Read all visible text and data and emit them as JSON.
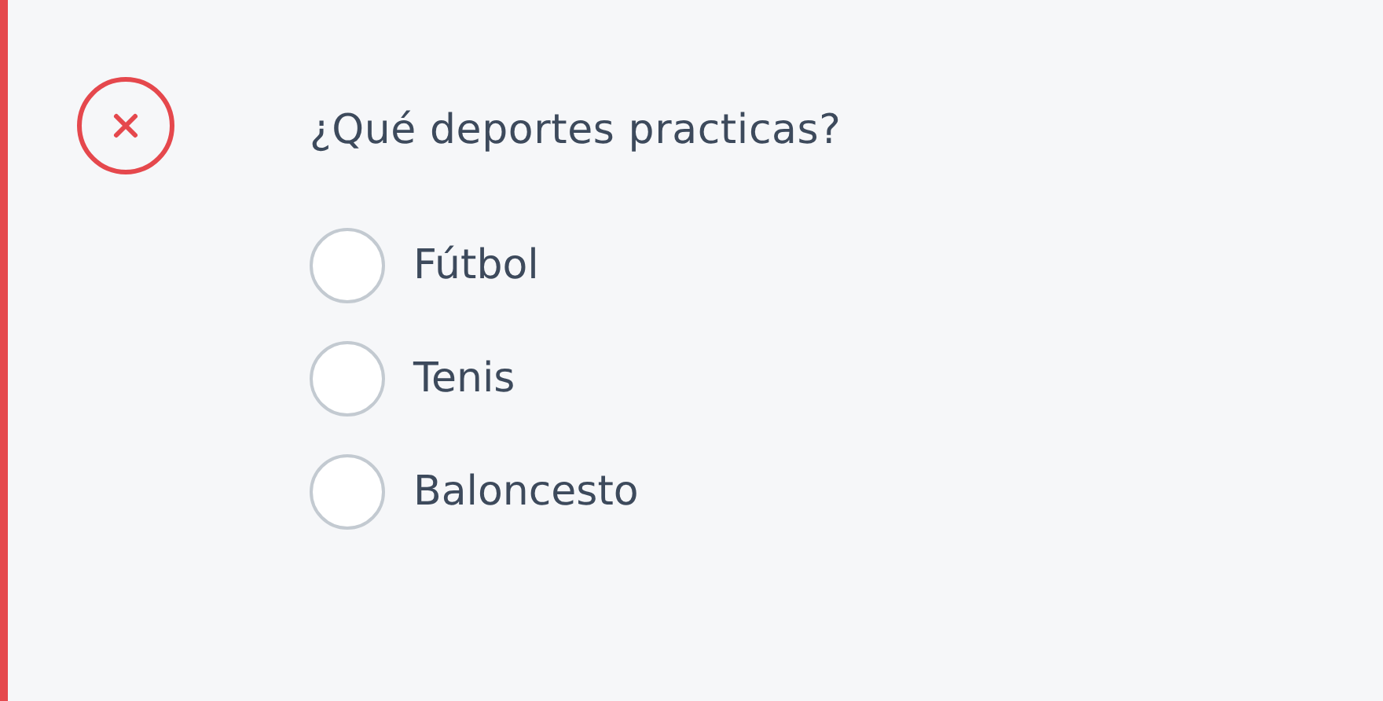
{
  "status": {
    "kind": "error"
  },
  "question": "¿Qué deportes practicas?",
  "options": [
    {
      "label": "Fútbol",
      "selected": false
    },
    {
      "label": "Tenis",
      "selected": false
    },
    {
      "label": "Baloncesto",
      "selected": false
    }
  ]
}
